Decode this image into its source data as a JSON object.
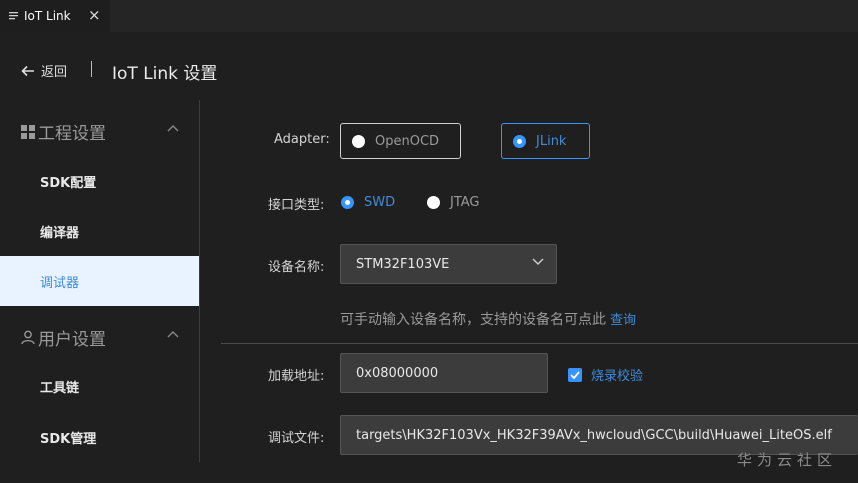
{
  "tab": {
    "title": "IoT Link",
    "close": "×"
  },
  "header": {
    "back_label": "返回",
    "title": "IoT Link 设置"
  },
  "sidebar": {
    "groups": [
      {
        "label": "工程设置",
        "icon": "grid-icon",
        "expanded": true
      },
      {
        "label": "用户设置",
        "icon": "user-icon",
        "expanded": true
      }
    ],
    "items": [
      {
        "label": "SDK配置",
        "active": false
      },
      {
        "label": "编译器",
        "active": false
      },
      {
        "label": "调试器",
        "active": true
      },
      {
        "label": "工具链",
        "active": false
      },
      {
        "label": "SDK管理",
        "active": false
      }
    ]
  },
  "form": {
    "adapter": {
      "label": "Adapter:",
      "options": [
        {
          "label": "OpenOCD",
          "selected": false
        },
        {
          "label": "JLink",
          "selected": true
        }
      ]
    },
    "interface": {
      "label": "接口类型:",
      "options": [
        {
          "label": "SWD",
          "selected": true
        },
        {
          "label": "JTAG",
          "selected": false
        }
      ]
    },
    "device": {
      "label": "设备名称:",
      "value": "STM32F103VE",
      "hint": "可手动输入设备名称，支持的设备名可点此",
      "hint_link": "查询"
    },
    "load_address": {
      "label": "加载地址:",
      "value": "0x08000000",
      "verify_label": "烧录校验",
      "verify_checked": true
    },
    "debug_file": {
      "label": "调试文件:",
      "value": "targets\\HK32F103Vx_HK32F39AVx_hwcloud\\GCC\\build\\Huawei_LiteOS.elf"
    }
  },
  "watermark": "华为云社区",
  "colors": {
    "accent": "#3794ff",
    "link": "#3f8bd8",
    "active_bg": "#e8f3ff",
    "bg": "#1f1f1f"
  }
}
